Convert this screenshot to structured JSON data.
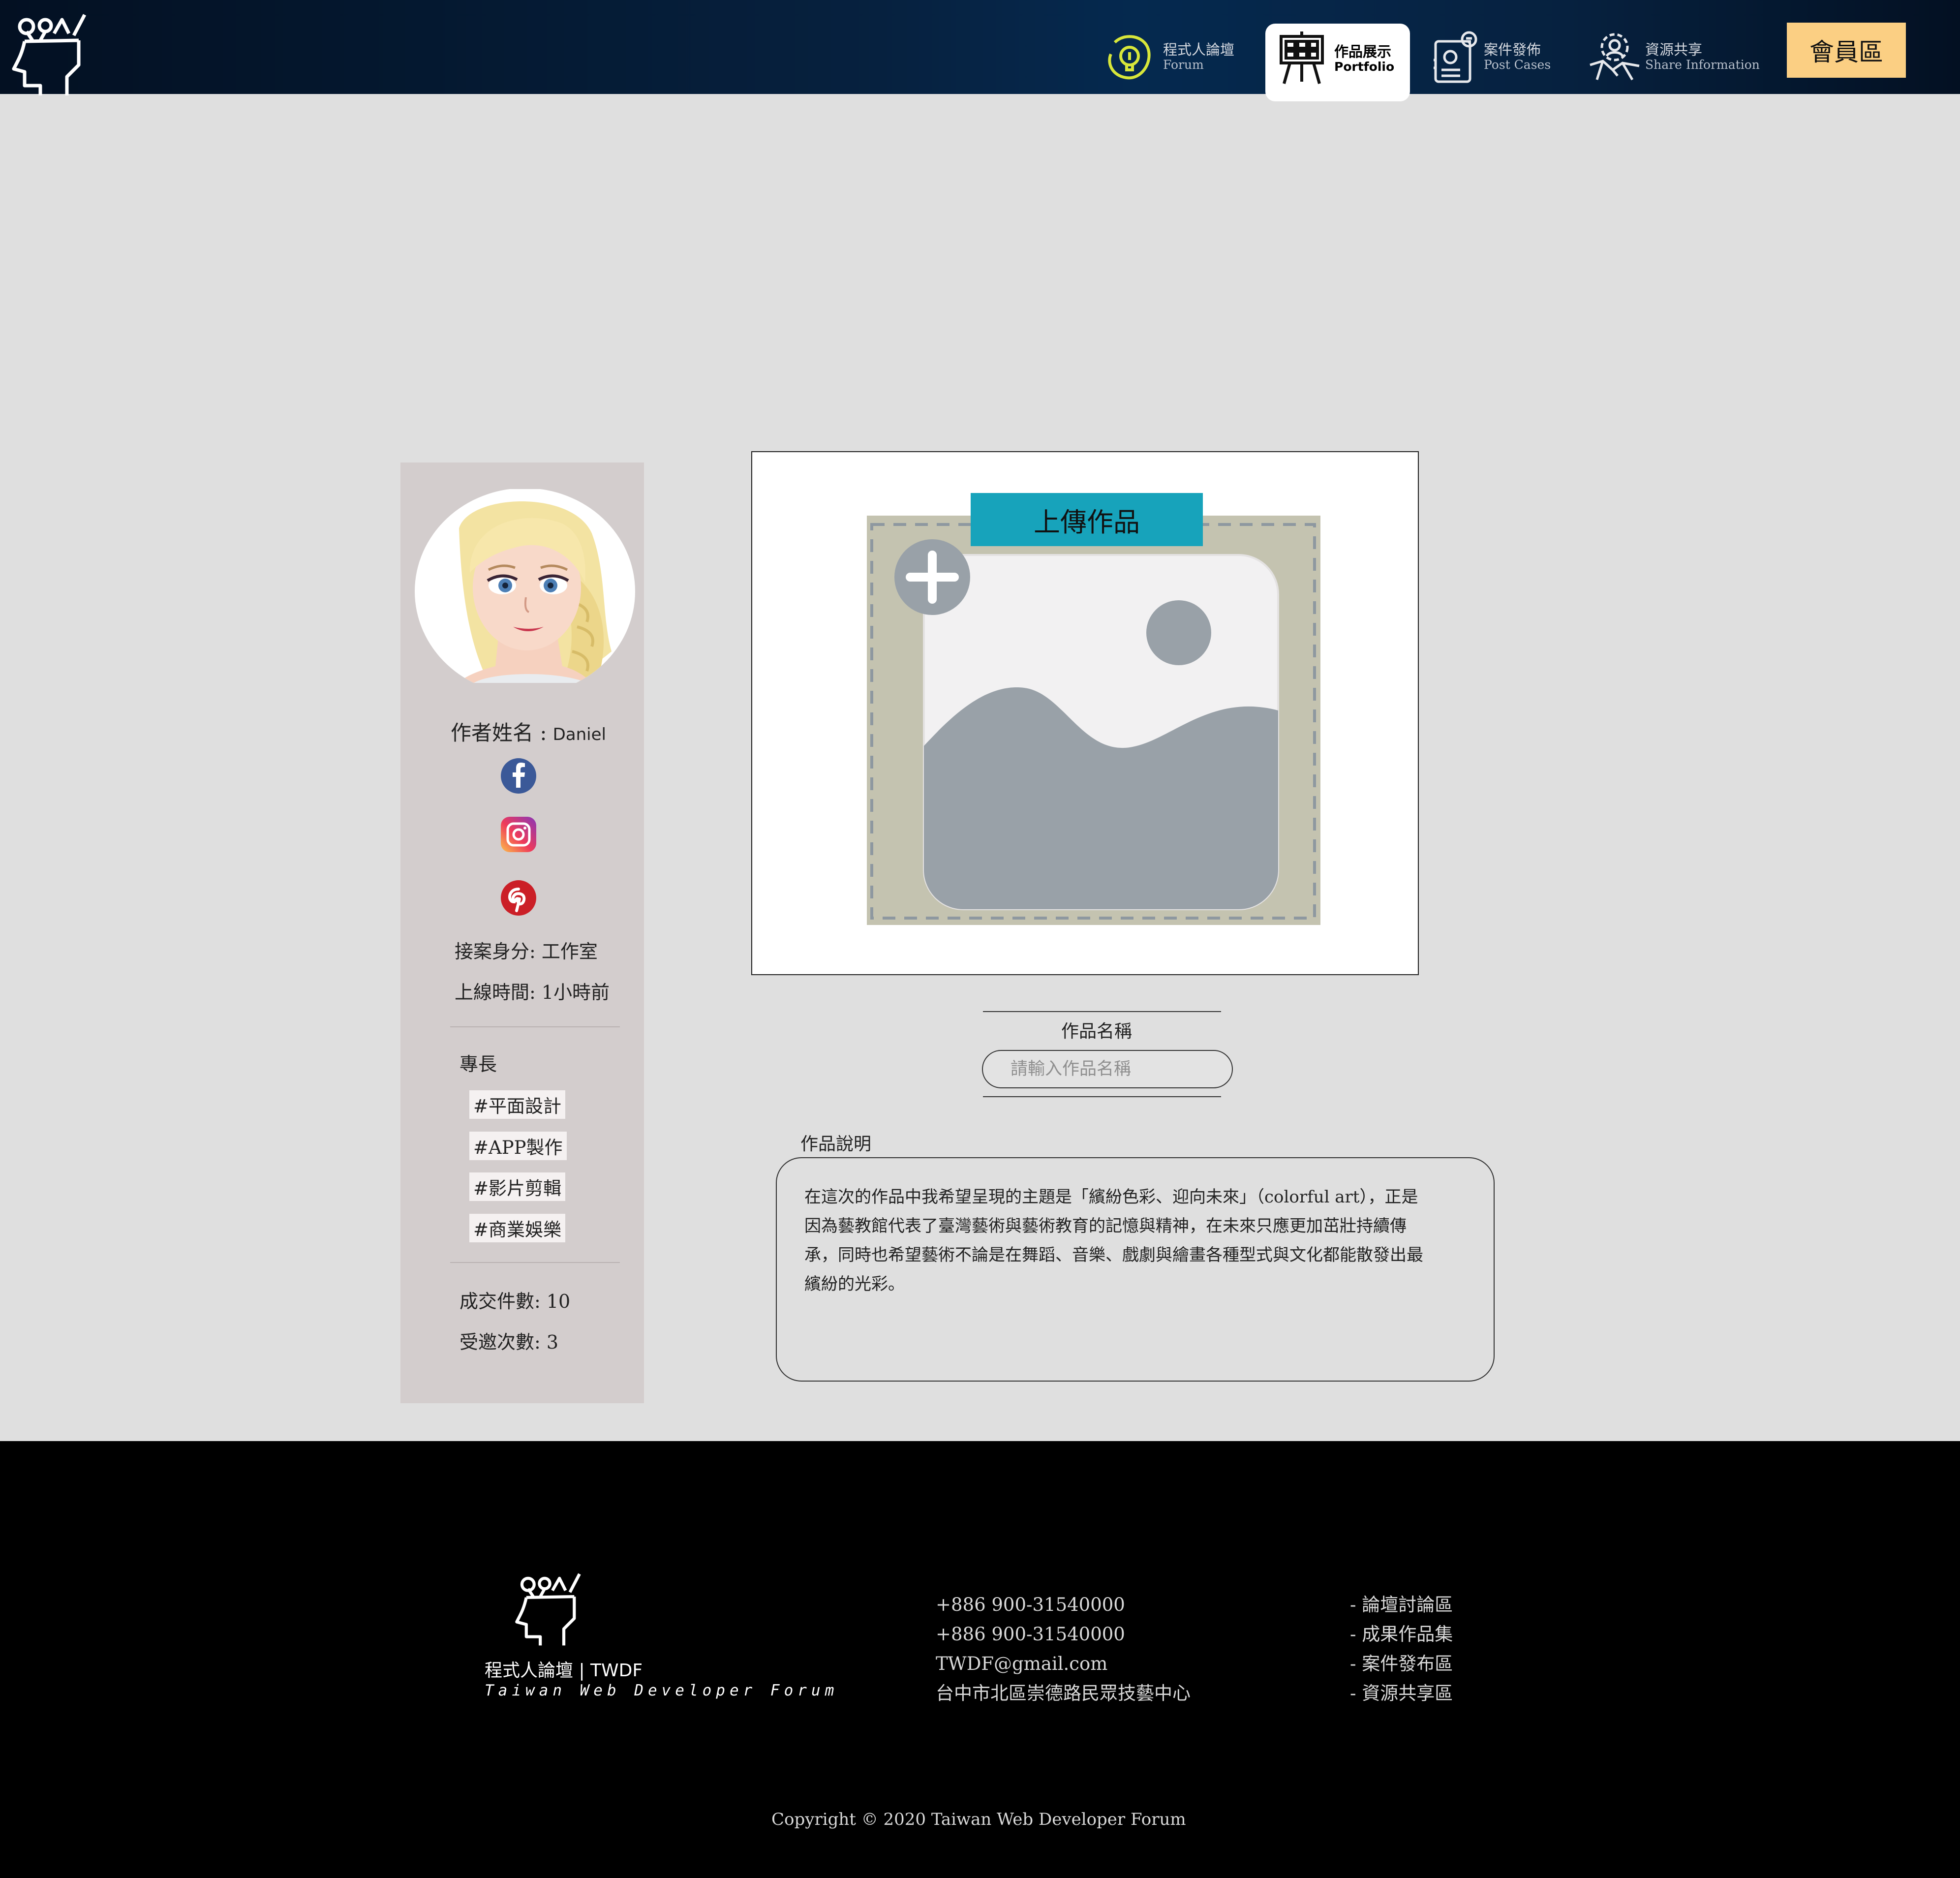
{
  "nav": {
    "forum": {
      "cn": "程式人論壇",
      "en": "Forum"
    },
    "portfolio": {
      "cn": "作品展示",
      "en": "Portfolio"
    },
    "cases": {
      "cn": "案件發佈",
      "en": "Post Cases"
    },
    "share": {
      "cn": "資源共享",
      "en": "Share Information"
    },
    "member": "會員區"
  },
  "profile": {
    "name_label": "作者姓名 :",
    "name": "Daniel",
    "social": [
      "facebook-icon",
      "instagram-icon",
      "pinterest-icon"
    ],
    "role": "接案身分: 工作室",
    "online": "上線時間: 1小時前",
    "skills_label": "專長",
    "tags": [
      "#平面設計",
      "#APP製作",
      "#影片剪輯",
      "#商業娛樂"
    ],
    "deals": "成交件數: 10",
    "invites": "受邀次數:  3"
  },
  "upload": {
    "title": "上傳作品",
    "name_label": "作品名稱",
    "name_placeholder": "請輸入作品名稱",
    "desc_label": "作品說明",
    "desc": "在這次的作品中我希望呈現的主題是「繽紛色彩、迎向未來」（colorful art），正是因為藝教館代表了臺灣藝術與藝術教育的記憶與精神，在未來只應更加茁壯持續傳承，同時也希望藝術不論是在舞蹈、音樂、戲劇與繪畫各種型式與文化都能散發出最繽紛的光彩。"
  },
  "footer": {
    "brand": "程式人論壇 | TWDF",
    "brand_sub": "Taiwan Web Developer Forum",
    "contact": [
      "+886 900-31540000",
      "+886 900-31540000",
      "TWDF@gmail.com",
      "台中市北區崇德路民眾技藝中心"
    ],
    "links": [
      "- 論壇討論區",
      "- 成果作品集",
      "- 案件發布區",
      "- 資源共享區"
    ],
    "copyright": "Copyright © 2020 Taiwan Web Developer Forum"
  },
  "colors": {
    "header": "#03142b",
    "accent_upload": "#17a3bb",
    "member_button": "#fbcf83",
    "sidebar": "#d3cdcd",
    "forum_icon": "#d7e63a"
  }
}
